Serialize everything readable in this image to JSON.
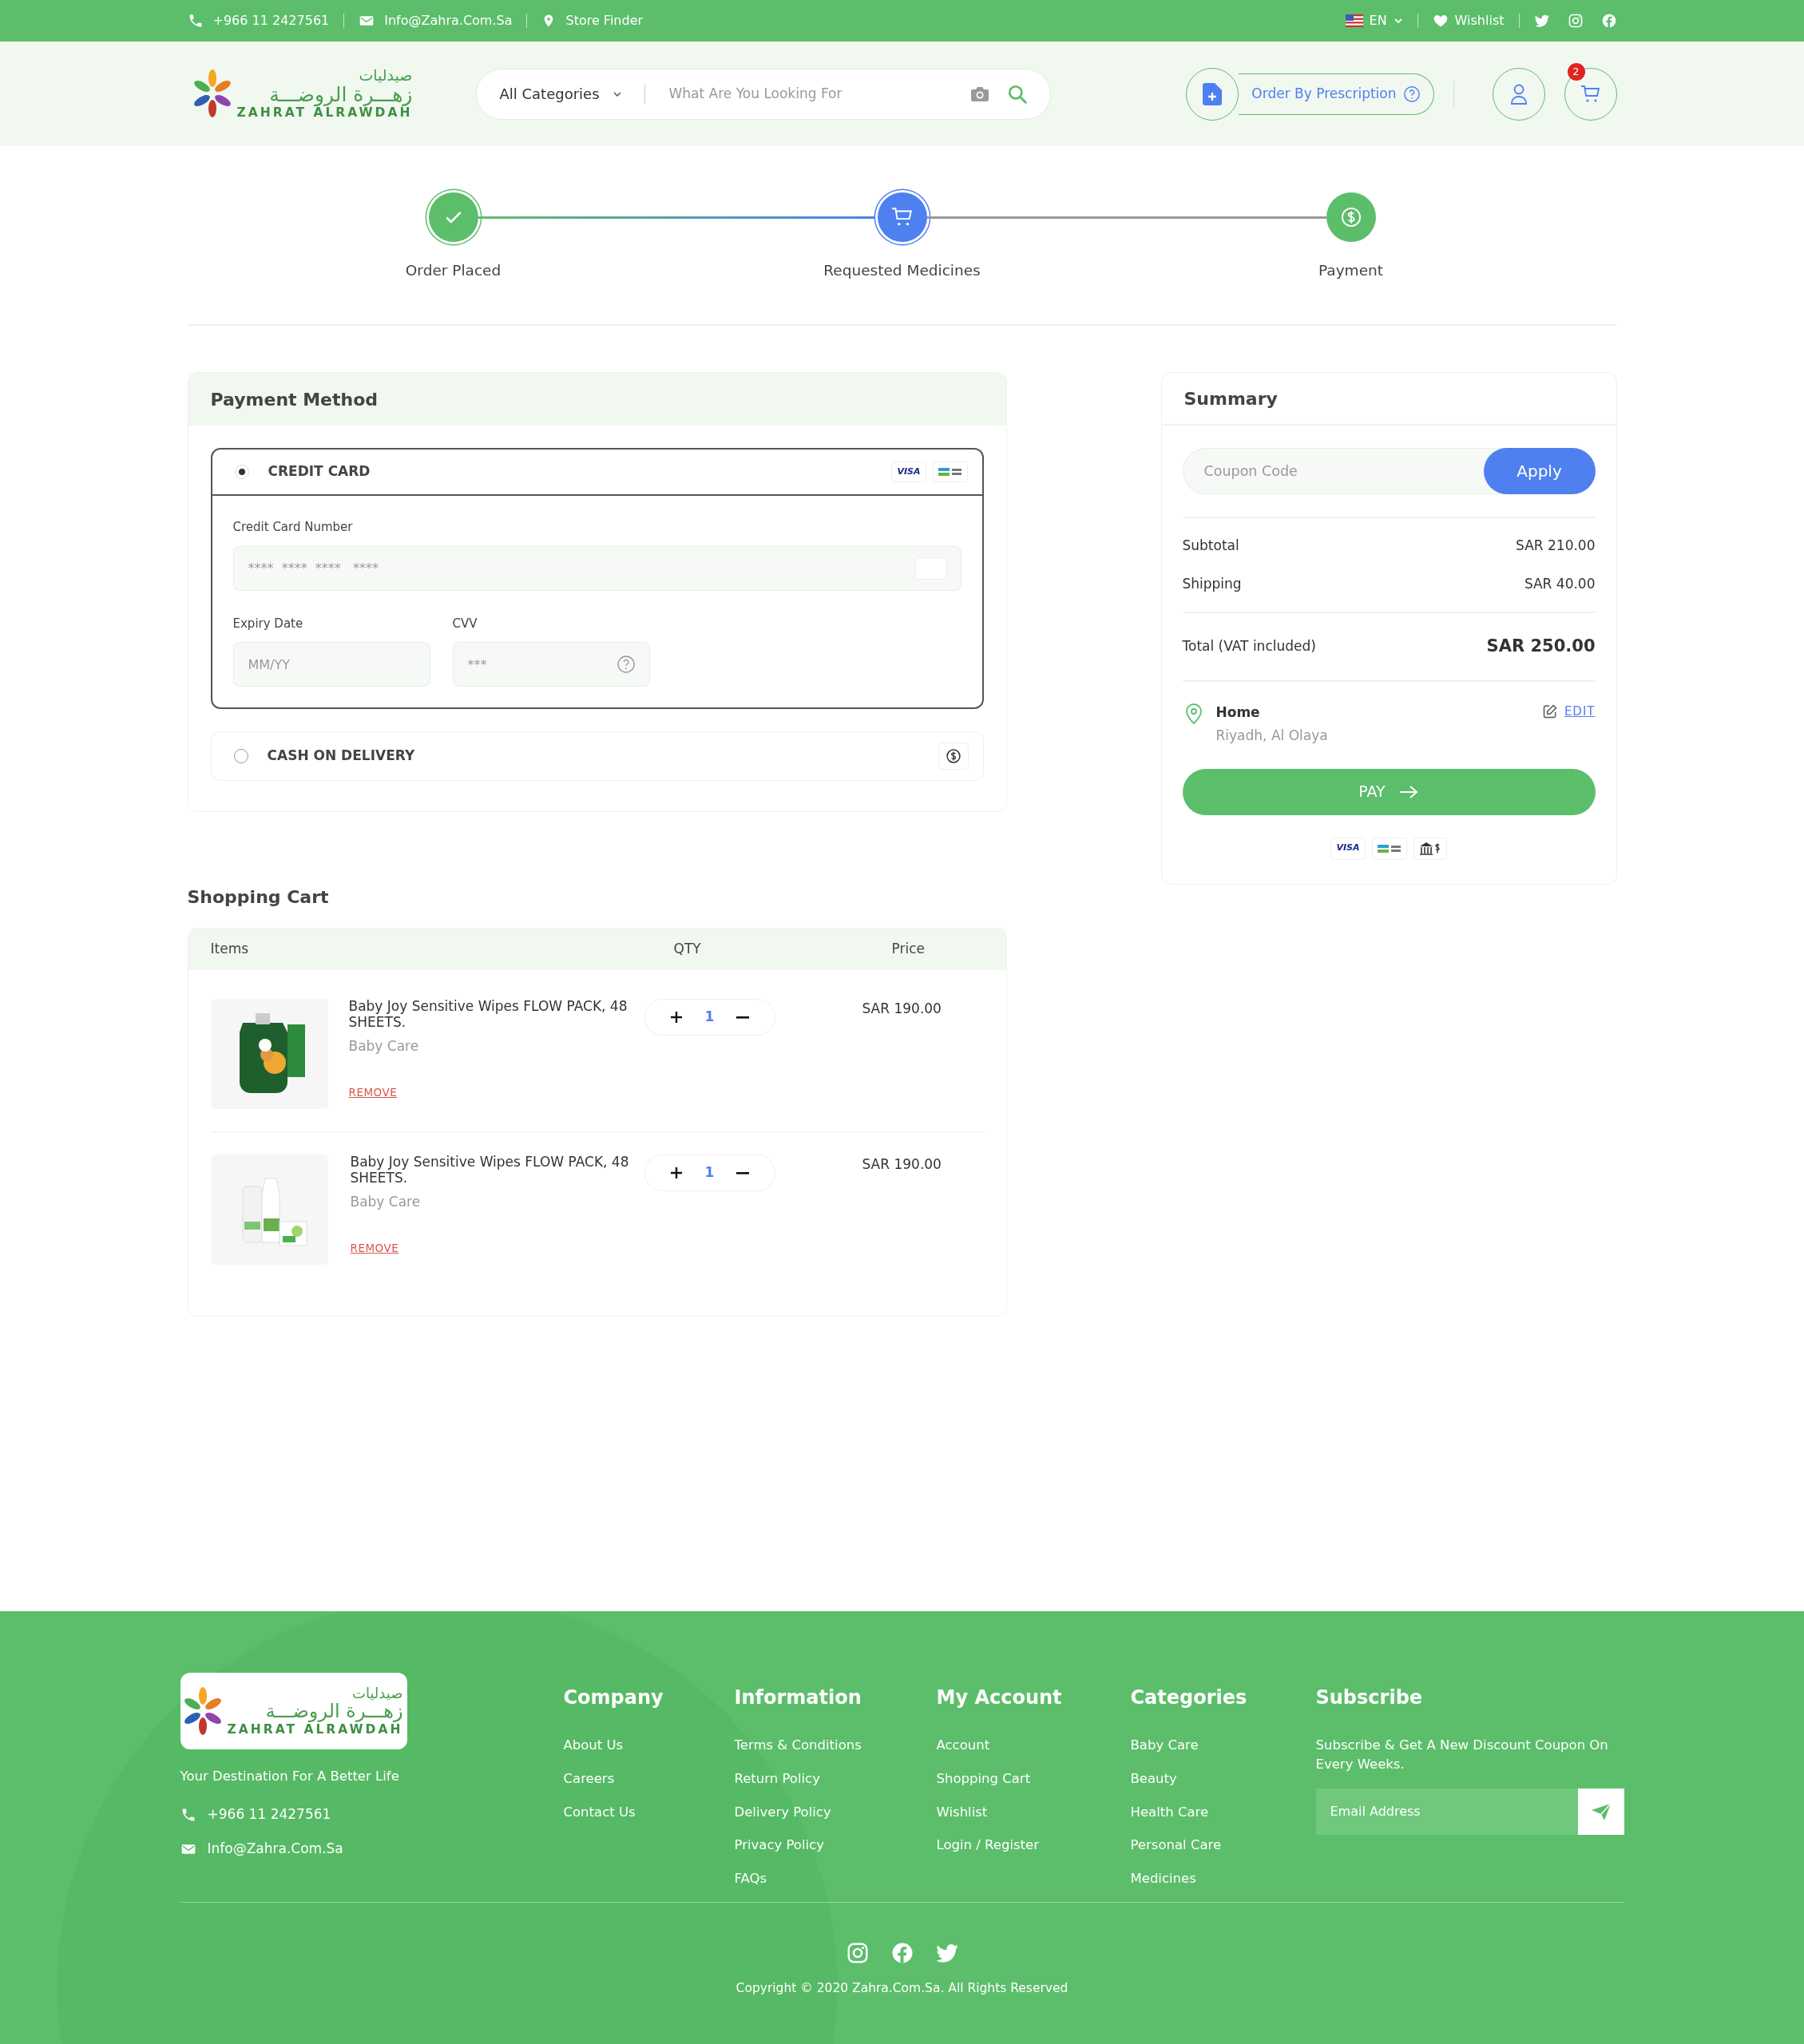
{
  "top_bar": {
    "phone": "+966 11 2427561",
    "email": "Info@Zahra.Com.Sa",
    "store_finder": "Store Finder",
    "language": "EN",
    "wishlist": "Wishlist"
  },
  "header": {
    "logo": {
      "arabic_top": "صيدليات",
      "arabic_main": "زهـــرة الروضـــة",
      "latin": "ZAHRAT ALRAWDAH"
    },
    "category": "All Categories",
    "search": {
      "placeholder": "What Are You Looking For"
    },
    "prescription": "Order By Prescription",
    "cart_count": "2"
  },
  "steps": [
    {
      "label": "Order Placed",
      "completed": true,
      "current": false
    },
    {
      "label": "Requested Medicines",
      "completed": false,
      "current": true
    },
    {
      "label": "Payment",
      "completed": false,
      "current": false
    }
  ],
  "payment_method": {
    "title": "Payment Method",
    "options": [
      {
        "kind": "card",
        "label": "CREDIT CARD",
        "selected": true,
        "badge": "VISA"
      },
      {
        "kind": "cash",
        "label": "CASH ON DELIVERY",
        "selected": false
      }
    ],
    "card_number": {
      "label": "Credit Card Number",
      "placeholder": "****  ****  ****   ****"
    },
    "expiry": {
      "label": "Expiry Date",
      "placeholder": "MM/YY"
    },
    "cvv": {
      "label": "CVV",
      "placeholder": "***"
    }
  },
  "summary": {
    "title": "Summary",
    "coupon": {
      "placeholder": "Coupon Code"
    },
    "apply": "Apply",
    "lines": [
      {
        "label": "Subtotal",
        "value": "SAR 210.00"
      },
      {
        "label": "Shipping",
        "value": "SAR 40.00"
      }
    ],
    "total": {
      "label": "Total (VAT included)",
      "value": "SAR 250.00"
    },
    "address": {
      "name": "Home",
      "detail": "Riyadh, Al Olaya",
      "edit": "EDIT"
    },
    "pay": "PAY",
    "badge": "VISA"
  },
  "cart": {
    "title": "Shopping Cart",
    "columns": [
      "Items",
      "QTY",
      "Price"
    ],
    "items": [
      {
        "kind": "picture",
        "name": "Baby Joy Sensitive Wipes FLOW PACK, 48 SHEETS.",
        "category": "Baby Care",
        "qty": "1",
        "price": "SAR 190.00",
        "remove": "REMOVE"
      },
      {
        "kind": "picture",
        "name": "Baby Joy Sensitive Wipes FLOW PACK, 48 SHEETS.",
        "category": "Baby Care",
        "qty": "1",
        "price": "SAR 190.00",
        "remove": "REMOVE"
      }
    ]
  },
  "footer": {
    "logo": {
      "arabic_top": "صيدليات",
      "arabic_main": "زهـــرة الروضـــة",
      "latin": "ZAHRAT ALRAWDAH"
    },
    "tagline": "Your Destination For A Better Life",
    "phone": "+966 11 2427561",
    "email": "Info@Zahra.Com.Sa",
    "columns": [
      {
        "title": "Company",
        "links": [
          "About Us",
          "Careers",
          "Contact Us"
        ]
      },
      {
        "title": "Information",
        "links": [
          "Terms & Conditions",
          "Return Policy",
          "Delivery Policy",
          "Privacy Policy",
          "FAQs"
        ]
      },
      {
        "title": "My Account",
        "links": [
          "Account",
          "Shopping Cart",
          "Wishlist",
          "Login / Register"
        ]
      },
      {
        "title": "Categories",
        "links": [
          "Baby Care",
          "Beauty",
          "Health Care",
          "Personal Care",
          "Medicines"
        ]
      }
    ],
    "subscribe": {
      "title": "Subscribe",
      "text": "Subscribe & Get A New Discount Coupon On Every Weeks.",
      "placeholder": "Email Address"
    },
    "copyright": "Copyright © 2020 Zahra.Com.Sa. All Rights Reserved"
  }
}
